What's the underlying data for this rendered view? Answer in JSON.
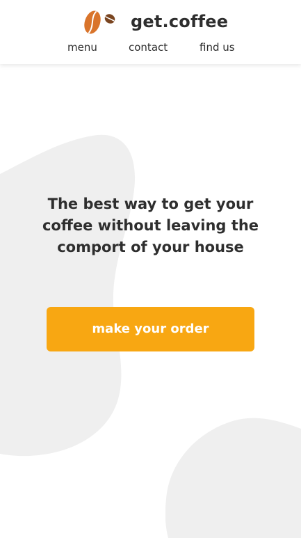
{
  "header": {
    "brand_name": "get.coffee",
    "logo_icon": "coffee-beans-logo",
    "nav": {
      "menu": "menu",
      "contact": "contact",
      "find_us": "find us"
    }
  },
  "hero": {
    "headline": "The best way to get your coffee without leaving the comport of your house",
    "cta_label": "make your order"
  },
  "colors": {
    "accent": "#f8a712",
    "bean_orange": "#d9742b",
    "bean_brown": "#7a4520",
    "blob": "#efefef",
    "text": "#2e2e2e"
  }
}
